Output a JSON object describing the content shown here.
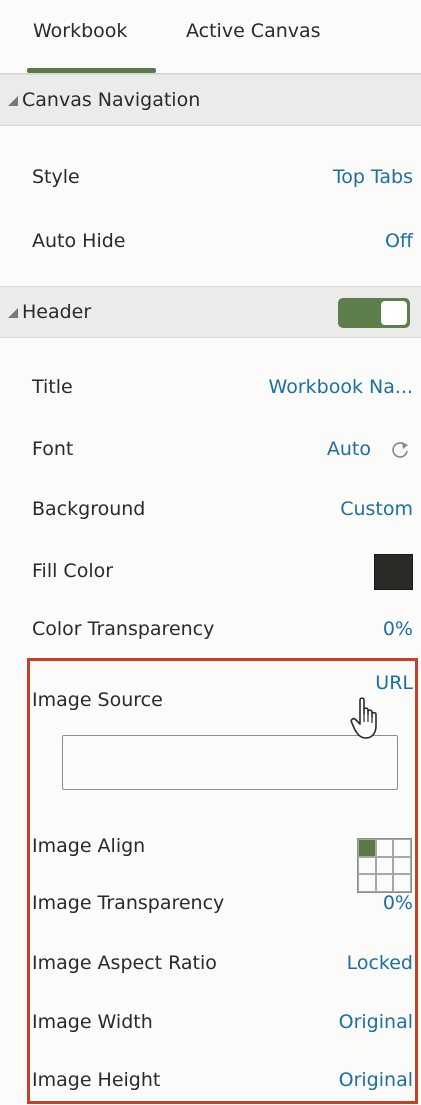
{
  "tabs": [
    {
      "label": "Workbook",
      "active": true
    },
    {
      "label": "Active Canvas",
      "active": false
    }
  ],
  "canvas_navigation": {
    "section_label": "Canvas Navigation",
    "rows": [
      {
        "label": "Style",
        "value": "Top Tabs"
      },
      {
        "label": "Auto Hide",
        "value": "Off"
      }
    ]
  },
  "header": {
    "section_label": "Header",
    "toggle_on": true,
    "title": {
      "label": "Title",
      "value": "Workbook Na..."
    },
    "font": {
      "label": "Font",
      "value": "Auto",
      "icon": "reset-icon"
    },
    "background": {
      "label": "Background",
      "value": "Custom"
    },
    "fill_color": {
      "label": "Fill Color",
      "color": "#2b2a27"
    },
    "color_transparency": {
      "label": "Color Transparency",
      "value": "0%"
    },
    "image_source": {
      "label": "Image Source",
      "value": "URL",
      "input_value": ""
    },
    "image_align": {
      "label": "Image Align",
      "selected_cell": "top-left"
    },
    "image_transparency": {
      "label": "Image Transparency",
      "value": "0%"
    },
    "image_aspect_ratio": {
      "label": "Image Aspect Ratio",
      "value": "Locked"
    },
    "image_width": {
      "label": "Image Width",
      "value": "Original"
    },
    "image_height": {
      "label": "Image Height",
      "value": "Original"
    }
  },
  "colors": {
    "accent_green": "#58794a",
    "link_blue": "#1d6fa0",
    "highlight_red": "#c7402c"
  }
}
